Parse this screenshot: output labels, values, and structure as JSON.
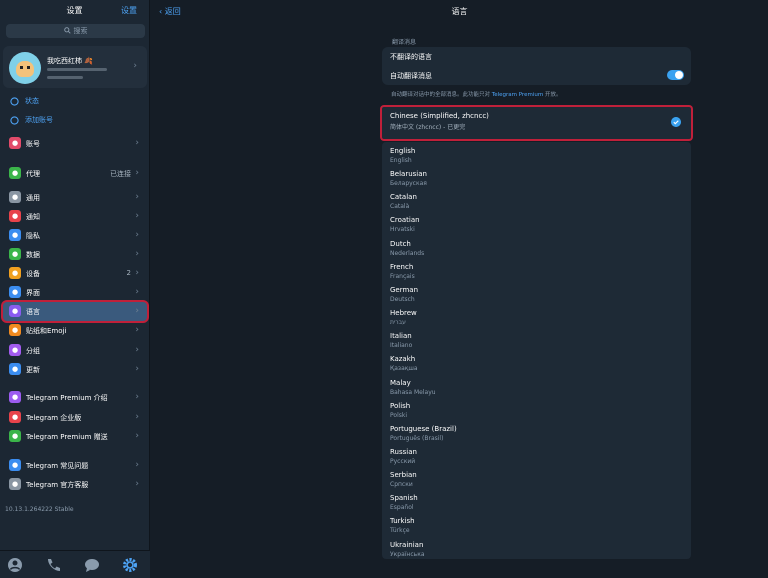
{
  "sidebar": {
    "title": "设置",
    "edit": "设置",
    "search_placeholder": "搜索",
    "profile_name": "我吃西红柿 🍂",
    "links": [
      {
        "label": "状态",
        "icon": "status-icon"
      },
      {
        "label": "添加账号",
        "icon": "add-account-icon"
      }
    ],
    "items": [
      {
        "label": "账号",
        "icon": "account-icon",
        "color": "#e24b6a",
        "value": ""
      },
      {
        "label": "代理",
        "icon": "proxy-icon",
        "color": "#3bb54a",
        "value": "已连接"
      },
      {
        "label": "通用",
        "icon": "gear-icon",
        "color": "#8a96a3",
        "value": ""
      },
      {
        "label": "通知",
        "icon": "bell-icon",
        "color": "#e8434b",
        "value": ""
      },
      {
        "label": "隐私",
        "icon": "lock-icon",
        "color": "#3b8df0",
        "value": ""
      },
      {
        "label": "数据",
        "icon": "data-icon",
        "color": "#3bb54a",
        "value": ""
      },
      {
        "label": "设备",
        "icon": "device-icon",
        "color": "#f0a020",
        "value": "2"
      },
      {
        "label": "界面",
        "icon": "brush-icon",
        "color": "#3b8df0",
        "value": ""
      },
      {
        "label": "语言",
        "icon": "globe-icon",
        "color": "#8a5cf0",
        "value": ""
      },
      {
        "label": "贴纸和Emoji",
        "icon": "sticker-icon",
        "color": "#f08a20",
        "value": ""
      },
      {
        "label": "分组",
        "icon": "folder-icon",
        "color": "#a35cf0",
        "value": ""
      },
      {
        "label": "更新",
        "icon": "update-icon",
        "color": "#3b8df0",
        "value": ""
      },
      {
        "label": "Telegram Premium 介绍",
        "icon": "premium-star-icon",
        "color": "#9c5cf0",
        "value": ""
      },
      {
        "label": "Telegram 企业版",
        "icon": "business-icon",
        "color": "#e8434b",
        "value": ""
      },
      {
        "label": "Telegram Premium 赠送",
        "icon": "gift-icon",
        "color": "#3bb54a",
        "value": ""
      },
      {
        "label": "Telegram 常见问题",
        "icon": "faq-icon",
        "color": "#3b8df0",
        "value": ""
      },
      {
        "label": "Telegram 官方客服",
        "icon": "support-icon",
        "color": "#8a96a3",
        "value": ""
      }
    ],
    "version": "10.13.1.264222 Stable",
    "tabs": [
      "contacts-icon",
      "calls-icon",
      "chats-icon",
      "settings-icon"
    ]
  },
  "main": {
    "back_label": "返回",
    "title": "语言",
    "translate_header": "翻译消息",
    "no_translate": "不翻译的语言",
    "auto_translate": "自动翻译消息",
    "auto_translate_on": true,
    "footnote_pre": "自动翻译对话中的全部消息。此功能只对",
    "footnote_link": "Telegram Premium",
    "footnote_post": "开放。",
    "selected": {
      "name": "Chinese (Simplified, zhcncc)",
      "native": "简体中文 (zhcncc) - 已更完"
    },
    "languages": [
      {
        "name": "English",
        "native": "English"
      },
      {
        "name": "Belarusian",
        "native": "Беларуская"
      },
      {
        "name": "Catalan",
        "native": "Català"
      },
      {
        "name": "Croatian",
        "native": "Hrvatski"
      },
      {
        "name": "Dutch",
        "native": "Nederlands"
      },
      {
        "name": "French",
        "native": "Français"
      },
      {
        "name": "German",
        "native": "Deutsch"
      },
      {
        "name": "Hebrew",
        "native": "עברית"
      },
      {
        "name": "Italian",
        "native": "Italiano"
      },
      {
        "name": "Kazakh",
        "native": "Қазақша"
      },
      {
        "name": "Malay",
        "native": "Bahasa Melayu"
      },
      {
        "name": "Polish",
        "native": "Polski"
      },
      {
        "name": "Portuguese (Brazil)",
        "native": "Português (Brasil)"
      },
      {
        "name": "Russian",
        "native": "Русский"
      },
      {
        "name": "Serbian",
        "native": "Српски"
      },
      {
        "name": "Spanish",
        "native": "Español"
      },
      {
        "name": "Turkish",
        "native": "Türkçe"
      },
      {
        "name": "Ukrainian",
        "native": "Українська"
      }
    ]
  }
}
